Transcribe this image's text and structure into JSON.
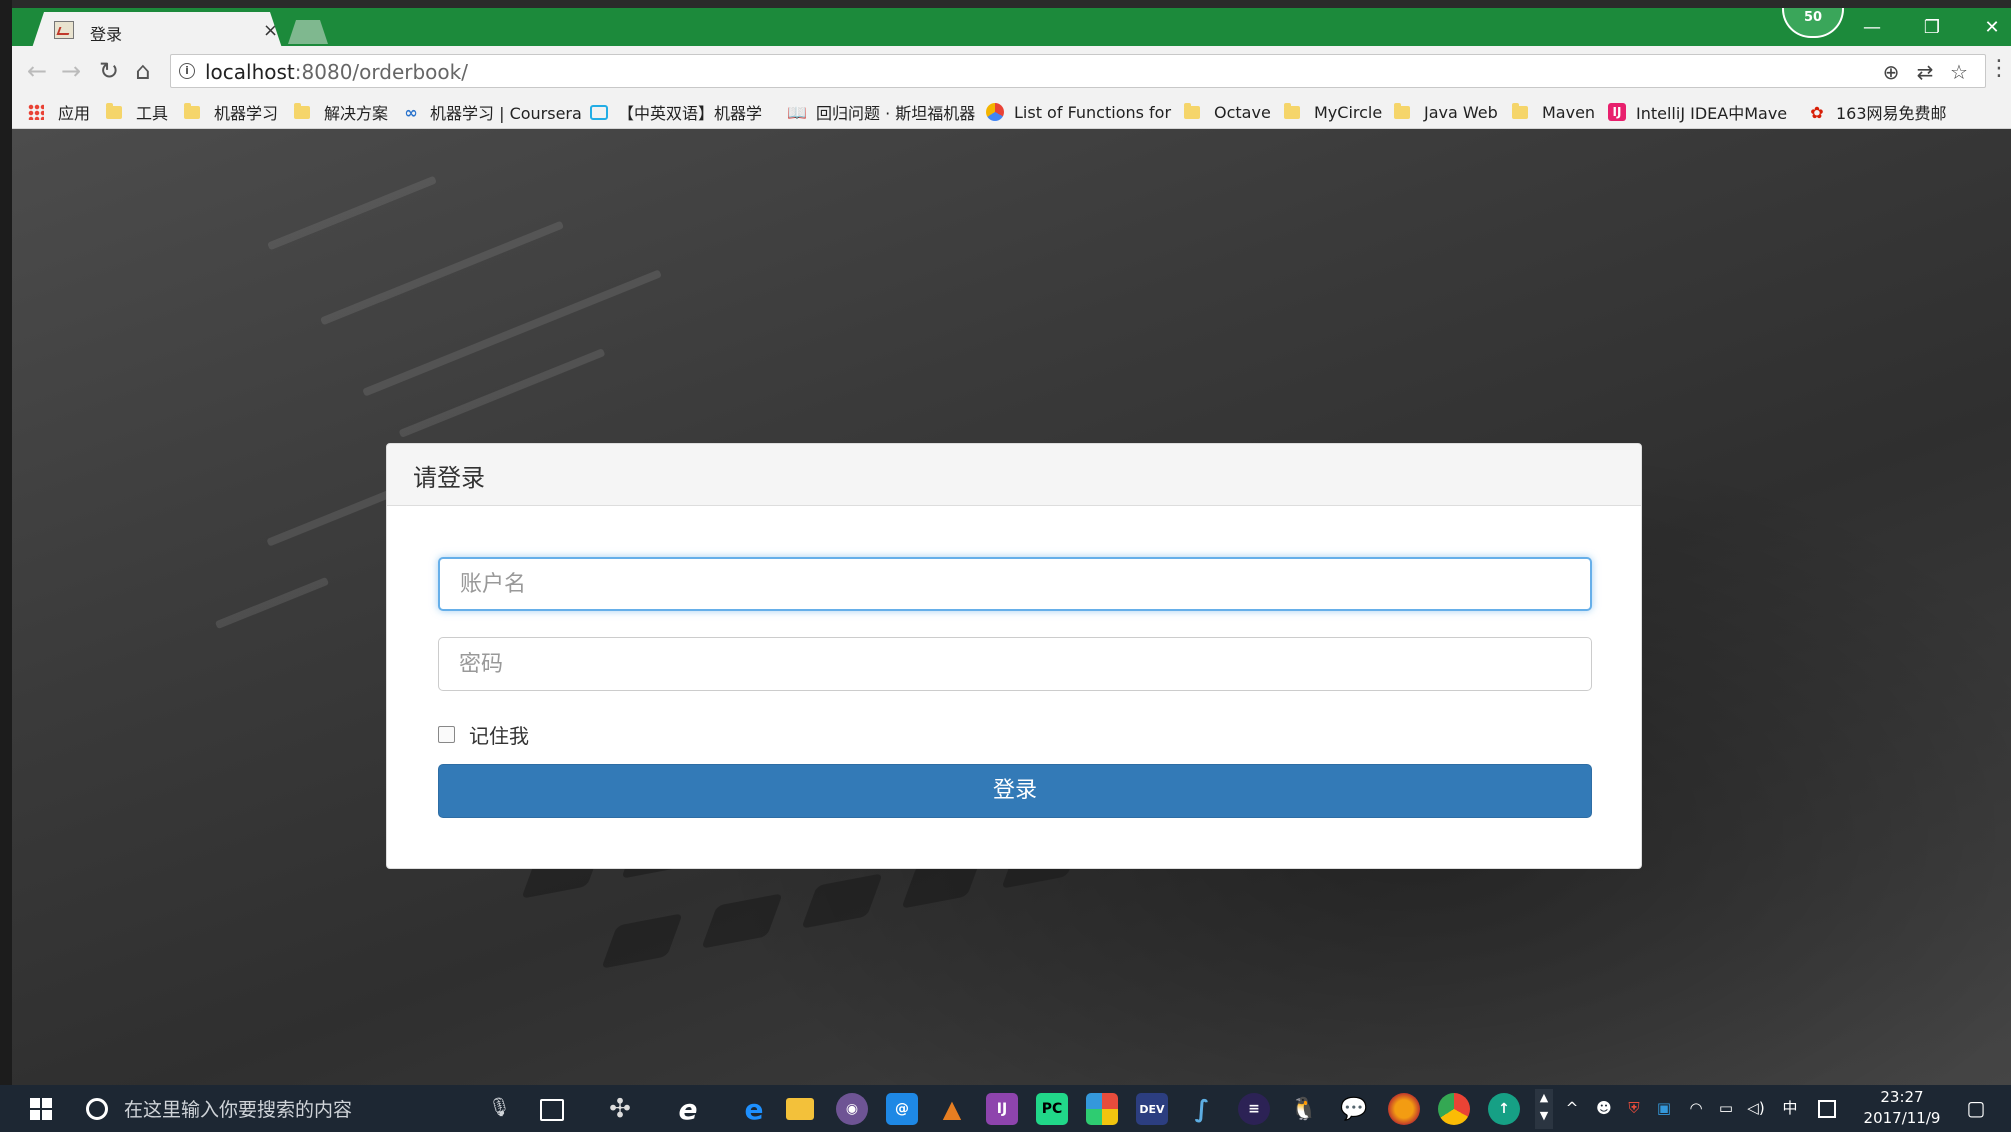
{
  "browser": {
    "tab_title": "登录",
    "tab_close": "×",
    "badge": "50",
    "url_host": "localhost",
    "url_rest": ":8080/orderbook/",
    "window_controls": {
      "minimize": "—",
      "restore": "❐",
      "close": "✕"
    }
  },
  "bookmarks": [
    {
      "label": "应用",
      "icon": "apps-grid-icon"
    },
    {
      "label": "工具",
      "icon": "folder-icon"
    },
    {
      "label": "机器学习",
      "icon": "folder-icon"
    },
    {
      "label": "解决方案",
      "icon": "folder-icon"
    },
    {
      "label": "机器学习 | Coursera",
      "icon": "coursera-icon"
    },
    {
      "label": "【中英双语】机器学",
      "icon": "bilibili-icon"
    },
    {
      "label": "回归问题 · 斯坦福机器",
      "icon": "book-icon"
    },
    {
      "label": "List of Functions for",
      "icon": "octave-icon"
    },
    {
      "label": "Octave",
      "icon": "folder-icon"
    },
    {
      "label": "MyCircle",
      "icon": "folder-icon"
    },
    {
      "label": "Java Web",
      "icon": "folder-icon"
    },
    {
      "label": "Maven",
      "icon": "folder-icon"
    },
    {
      "label": "IntelliJ IDEA中Mave",
      "icon": "intellij-icon"
    },
    {
      "label": "163网易免费邮",
      "icon": "netease-mail-icon"
    }
  ],
  "login": {
    "heading": "请登录",
    "username_placeholder": "账户名",
    "password_placeholder": "密码",
    "remember_label": "记住我",
    "submit_label": "登录"
  },
  "taskbar": {
    "search_placeholder": "在这里输入你要搜索的内容",
    "ime": "中",
    "time": "23:27",
    "date": "2017/11/9"
  },
  "colors": {
    "tabbar": "#1c8a3b",
    "primary_button": "#337ab7",
    "focus_border": "#66afe9",
    "taskbar": "#1d2733"
  }
}
